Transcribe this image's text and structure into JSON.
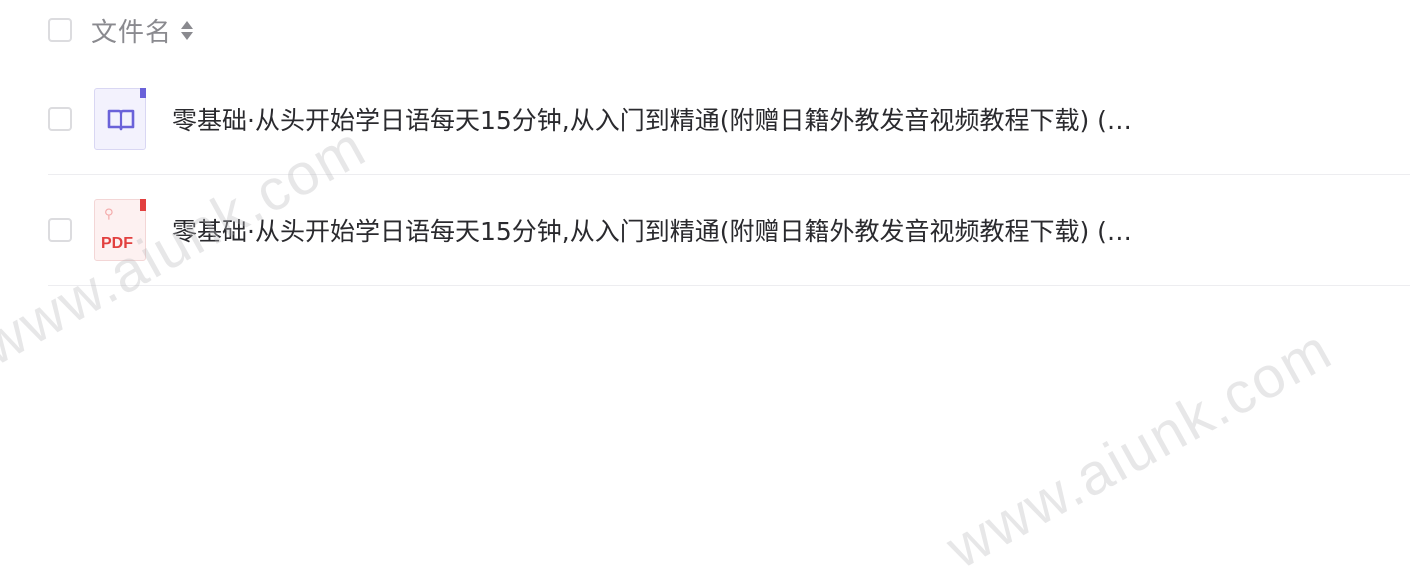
{
  "header": {
    "column_label": "文件名"
  },
  "files": [
    {
      "name": "零基础·从头开始学日语每天15分钟,从入门到精通(附赠日籍外教发音视频教程下载) (…",
      "icon": "book-icon"
    },
    {
      "name": "零基础·从头开始学日语每天15分钟,从入门到精通(附赠日籍外教发音视频教程下载) (…",
      "icon": "pdf-icon",
      "icon_label": "PDF"
    }
  ],
  "watermark": "www.aiunk.com",
  "colors": {
    "book_accent": "#6a62d9",
    "pdf_accent": "#e2403f"
  }
}
